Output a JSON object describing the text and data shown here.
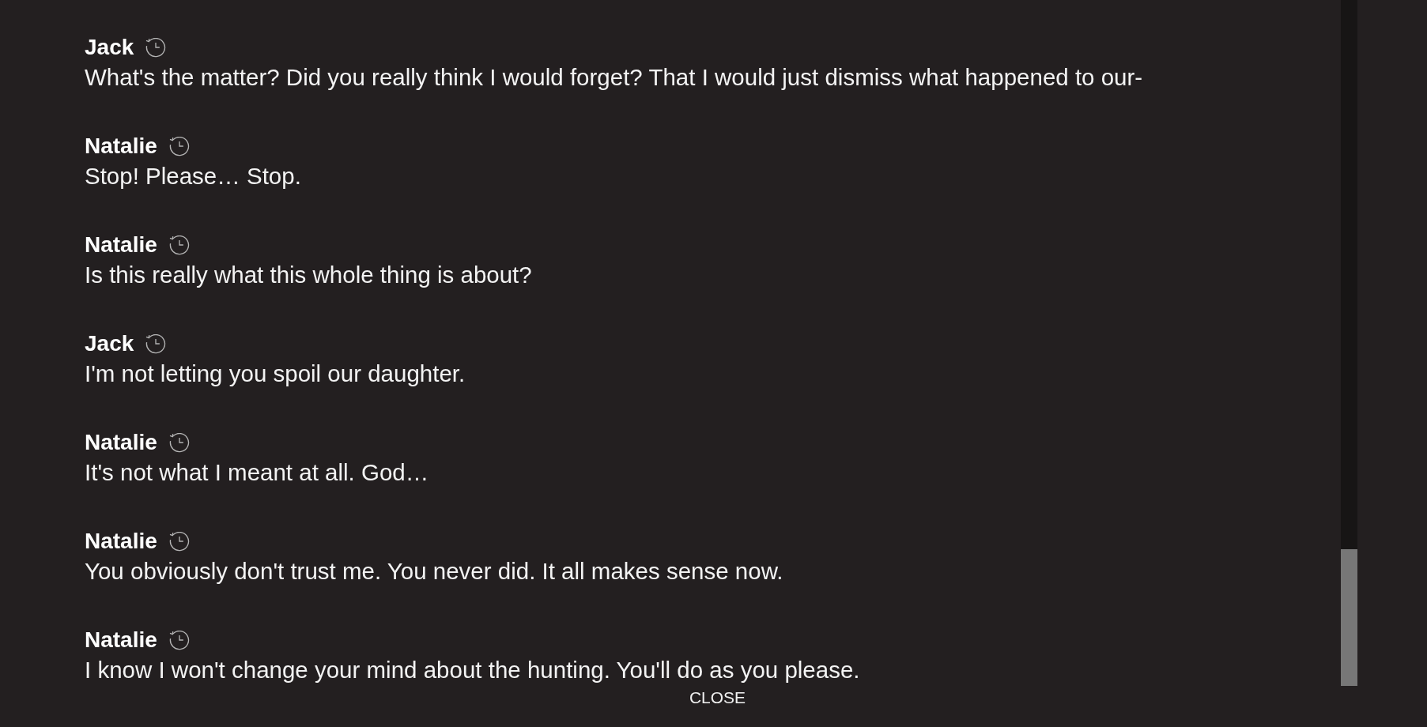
{
  "messages": [
    {
      "speaker": "Jack",
      "text": "What's the matter? Did you really think I would forget? That I would just dismiss what happened to our-"
    },
    {
      "speaker": "Natalie",
      "text": "Stop! Please… Stop."
    },
    {
      "speaker": "Natalie",
      "text": "Is this really what this whole thing is about?"
    },
    {
      "speaker": "Jack",
      "text": "I'm not letting you spoil our daughter."
    },
    {
      "speaker": "Natalie",
      "text": "It's not what I meant at all. God…"
    },
    {
      "speaker": "Natalie",
      "text": "You obviously don't trust me. You never did. It all makes sense now."
    },
    {
      "speaker": "Natalie",
      "text": "I know I won't change your mind about the hunting. You'll do as you please."
    }
  ],
  "close_button": "CLOSE"
}
